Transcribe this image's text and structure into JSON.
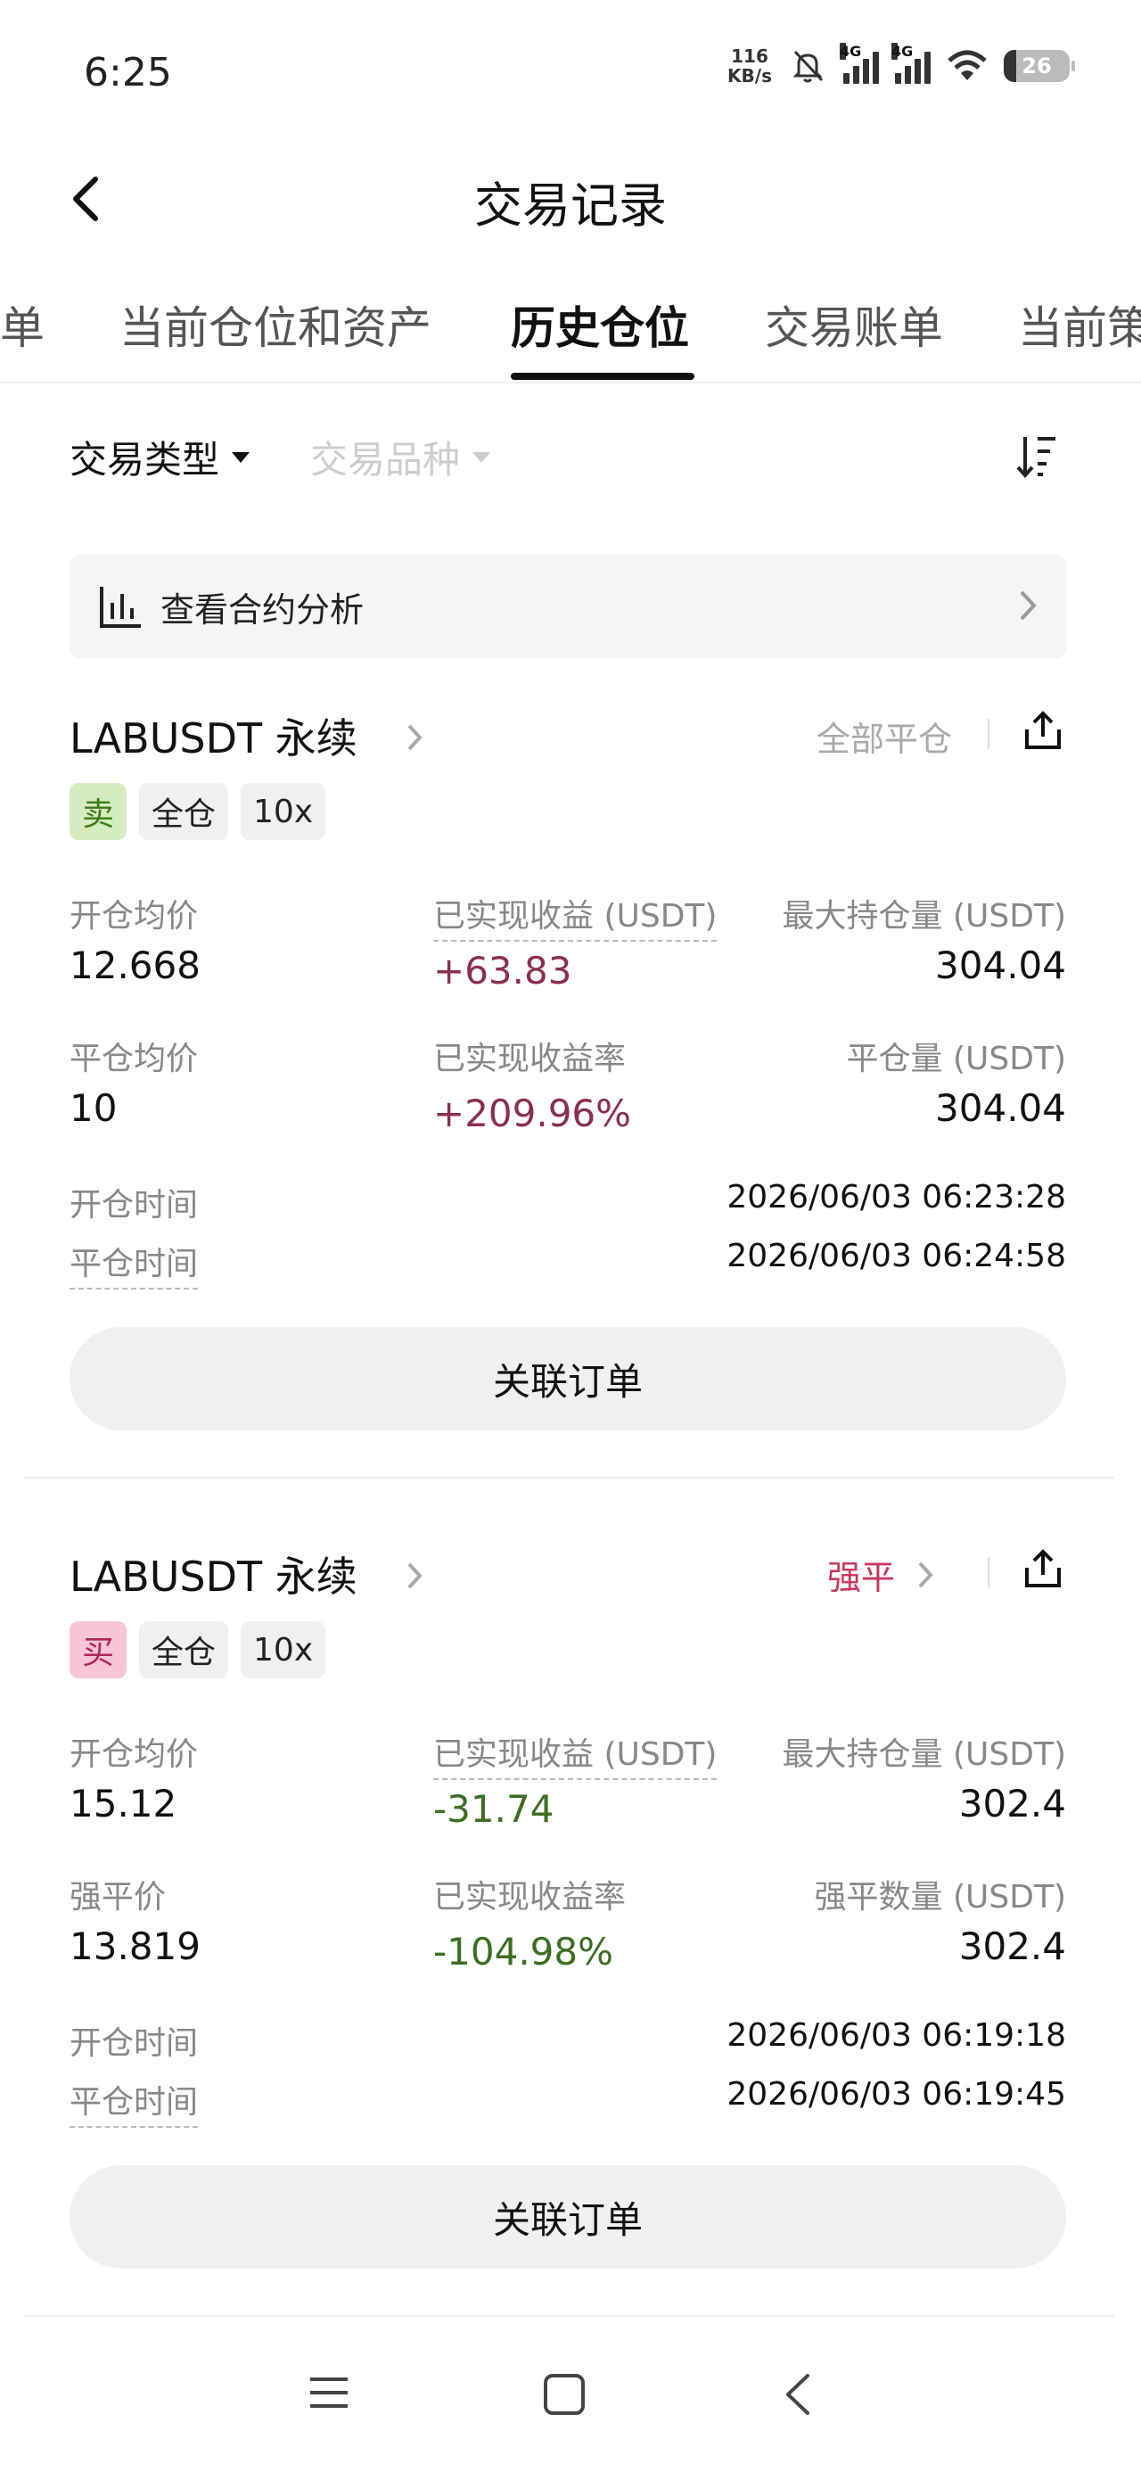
{
  "status_bar": {
    "time": "6:25",
    "net_speed_value": "116",
    "net_speed_unit": "KB/s",
    "signal_1": "4G",
    "signal_2": "4G",
    "battery": "26"
  },
  "header": {
    "title": "交易记录"
  },
  "tabs": [
    {
      "label": "单"
    },
    {
      "label": "当前仓位和资产"
    },
    {
      "label": "历史仓位",
      "active": true
    },
    {
      "label": "交易账单"
    },
    {
      "label": "当前策"
    }
  ],
  "filters": {
    "trade_type": "交易类型",
    "symbol": "交易品种"
  },
  "analysis": {
    "label": "查看合约分析"
  },
  "positions": [
    {
      "symbol": "LABUSDT 永续",
      "action": "全部平仓",
      "side": "卖",
      "margin_mode": "全仓",
      "leverage": "10x",
      "open_avg_label": "开仓均价",
      "open_avg_value": "12.668",
      "pnl_label": "已实现收益 (USDT)",
      "pnl_value": "+63.83",
      "max_label": "最大持仓量 (USDT)",
      "max_value": "304.04",
      "close_avg_label": "平仓均价",
      "close_avg_value": "10",
      "pnl_rate_label": "已实现收益率",
      "pnl_rate_value": "+209.96%",
      "close_qty_label": "平仓量 (USDT)",
      "close_qty_value": "304.04",
      "open_time_label": "开仓时间",
      "open_time": "2026/06/03 06:23:28",
      "close_time_label": "平仓时间",
      "close_time": "2026/06/03 06:24:58",
      "button": "关联订单"
    },
    {
      "symbol": "LABUSDT 永续",
      "action": "强平",
      "side": "买",
      "margin_mode": "全仓",
      "leverage": "10x",
      "open_avg_label": "开仓均价",
      "open_avg_value": "15.12",
      "pnl_label": "已实现收益 (USDT)",
      "pnl_value": "-31.74",
      "max_label": "最大持仓量 (USDT)",
      "max_value": "302.4",
      "close_avg_label": "强平价",
      "close_avg_value": "13.819",
      "pnl_rate_label": "已实现收益率",
      "pnl_rate_value": "-104.98%",
      "close_qty_label": "强平数量 (USDT)",
      "close_qty_value": "302.4",
      "open_time_label": "开仓时间",
      "open_time": "2026/06/03 06:19:18",
      "close_time_label": "平仓时间",
      "close_time": "2026/06/03 06:19:45",
      "button": "关联订单"
    }
  ],
  "colors": {
    "positive": "#8b2f4e",
    "negative": "#3c6e22",
    "liquidation": "#c8385f",
    "sell_tag_bg": "#d6ecbf",
    "buy_tag_bg": "#f8c5d6"
  },
  "icons": {
    "back": "chevron-left-icon",
    "sort": "sort-icon",
    "analysis": "bar-chart-icon",
    "share": "share-icon",
    "nav": [
      "menu-icon",
      "home-square-icon",
      "back-triangle-icon"
    ]
  }
}
